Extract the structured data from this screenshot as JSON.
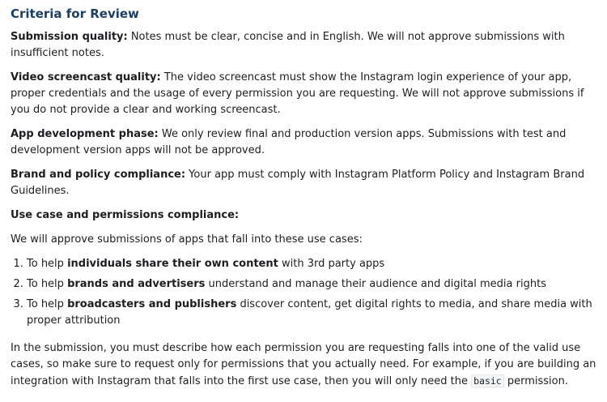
{
  "title": "Criteria for Review",
  "criteria": [
    {
      "label": "Submission quality:",
      "text": " Notes must be clear, concise and in English. We will not approve submissions with insufficient notes."
    },
    {
      "label": "Video screencast quality:",
      "text": " The video screencast must show the Instagram login experience of your app, proper credentials and the usage of every permission you are requesting. We will not approve submissions if you do not provide a clear and working screencast."
    },
    {
      "label": "App development phase:",
      "text": " We only review final and production version apps. Submissions with test and development version apps will not be approved."
    },
    {
      "label": "Brand and policy compliance:",
      "text": " Your app must comply with Instagram Platform Policy and Instagram Brand Guidelines."
    }
  ],
  "use_case_heading": "Use case and permissions compliance:",
  "use_case_intro": "We will approve submissions of apps that fall into these use cases:",
  "use_cases": [
    {
      "prefix": "To help ",
      "bold": "individuals share their own content",
      "suffix": " with 3rd party apps"
    },
    {
      "prefix": "To help ",
      "bold": "brands and advertisers",
      "suffix": " understand and manage their audience and digital media rights"
    },
    {
      "prefix": "To help ",
      "bold": "broadcasters and publishers",
      "suffix": " discover content, get digital rights to media, and share media with proper attribution"
    }
  ],
  "closing": {
    "before_code": "In the submission, you must describe how each permission you are requesting falls into one of the valid use cases, so make sure to request only for permissions that you actually need. For example, if you are building an integration with Instagram that falls into the first use case, then you will only need the ",
    "code": "basic",
    "after_code": " permission."
  }
}
